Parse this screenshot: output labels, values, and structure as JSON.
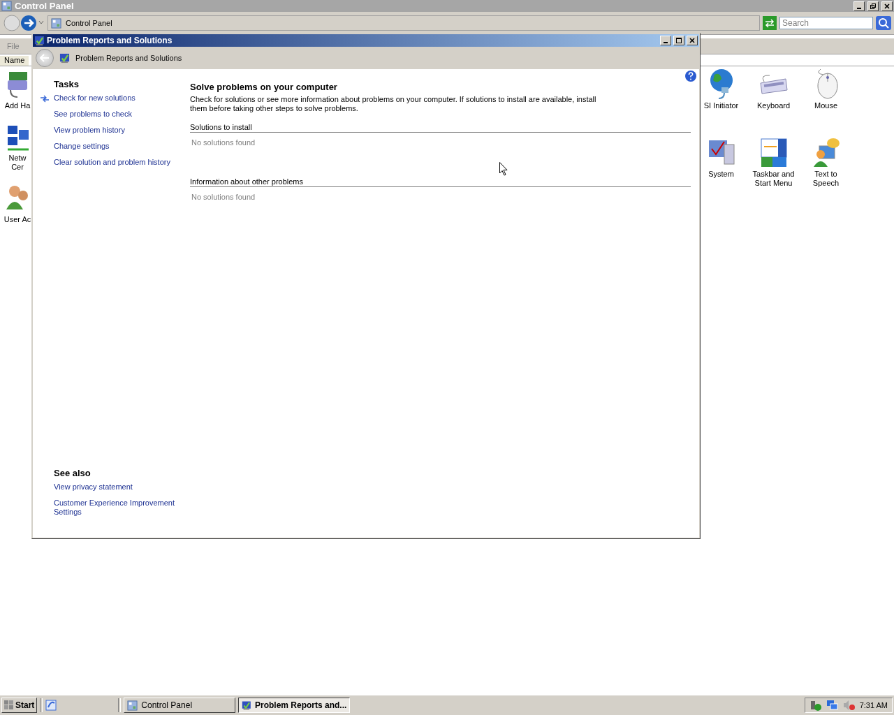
{
  "background_window": {
    "title": "Control Panel",
    "address": "Control Panel",
    "search": {
      "placeholder": "Search"
    },
    "menu": [
      "File"
    ],
    "columns": [
      "Name"
    ],
    "items_left": [
      {
        "kind": "hardware",
        "lines": [
          "Add Ha"
        ]
      },
      {
        "kind": "network",
        "lines": [
          "Netw",
          "Cer"
        ]
      },
      {
        "kind": "users",
        "lines": [
          "User Ac"
        ]
      }
    ],
    "items_right": [
      {
        "kind": "globe",
        "lines": [
          "SI Initiator"
        ]
      },
      {
        "kind": "keyboard",
        "lines": [
          "Keyboard"
        ]
      },
      {
        "kind": "mouse",
        "lines": [
          "Mouse"
        ]
      },
      {
        "kind": "system",
        "lines": [
          "System"
        ]
      },
      {
        "kind": "taskbar",
        "lines": [
          "Taskbar and",
          "Start Menu"
        ]
      },
      {
        "kind": "speech",
        "lines": [
          "Text to",
          "Speech"
        ]
      }
    ]
  },
  "dialog": {
    "title": "Problem Reports and Solutions",
    "breadcrumb": "Problem Reports and Solutions",
    "tasks": {
      "heading": "Tasks",
      "links": [
        {
          "label": "Check for new solutions",
          "kind": "action"
        },
        {
          "label": "See problems to check",
          "kind": "link"
        },
        {
          "label": "View problem history",
          "kind": "link"
        },
        {
          "label": "Change settings",
          "kind": "link"
        },
        {
          "label": "Clear solution and problem history",
          "kind": "link"
        }
      ]
    },
    "see_also": {
      "heading": "See also",
      "links": [
        "View privacy statement",
        "Customer Experience Improvement Settings"
      ]
    },
    "main": {
      "heading": "Solve problems on your computer",
      "intro": "Check for solutions or see more information about problems on your computer. If solutions to install are available, install them before taking other steps to solve problems.",
      "sections": [
        {
          "heading": "Solutions to install",
          "status": "No solutions found"
        },
        {
          "heading": "Information about other problems",
          "status": "No solutions found"
        }
      ]
    }
  },
  "taskbar": {
    "start": "Start",
    "buttons": [
      {
        "label": "Control Panel",
        "kind": "control-panel",
        "selected": false
      },
      {
        "label": "Problem Reports and...",
        "kind": "problem-reports",
        "selected": true
      }
    ],
    "clock": "7:31 AM"
  }
}
